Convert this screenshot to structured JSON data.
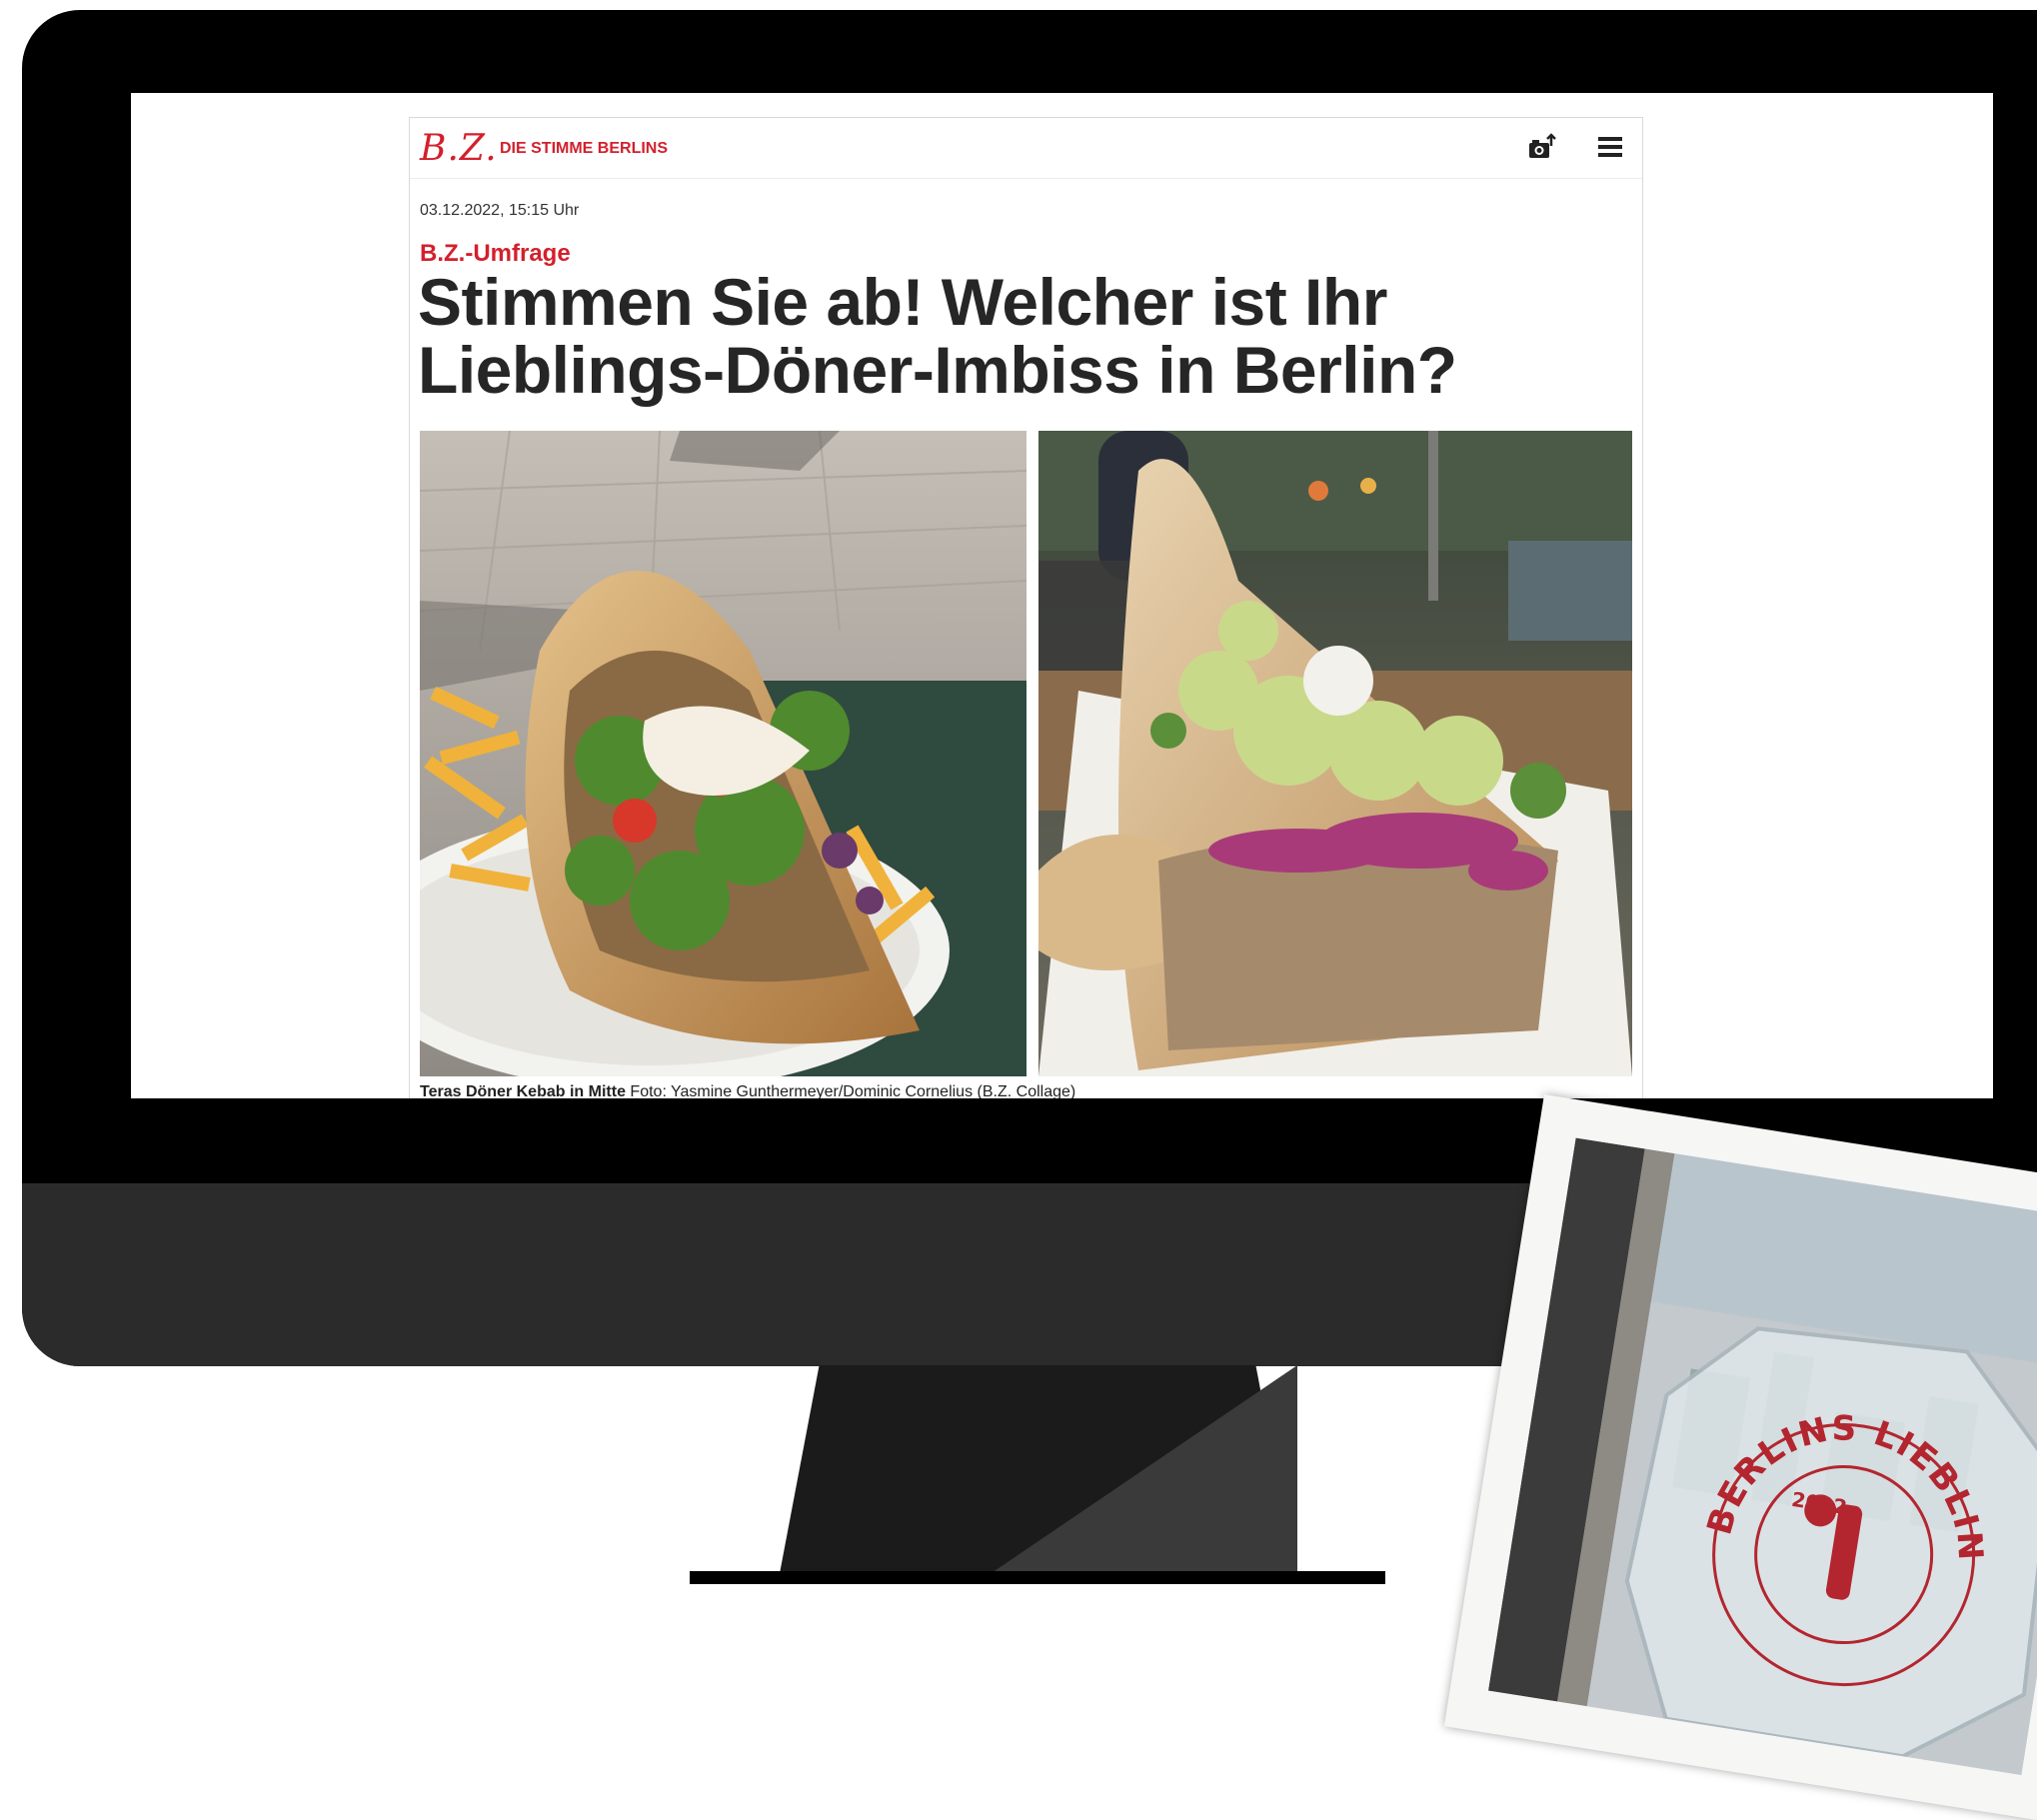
{
  "article": {
    "logo": "B.Z.",
    "tagline": "DIE STIMME BERLINS",
    "date": "03.12.2022, 15:15 Uhr",
    "kicker": "B.Z.-Umfrage",
    "headline_line1": "Stimmen Sie ab! Welcher ist Ihr",
    "headline_line2": "Lieblings-Döner-Imbiss in Berlin?",
    "caption_bold": "Teras Döner Kebab in Mitte",
    "caption_credit": "Foto: Yasmine Gunthermeyer/Dominic Cornelius (B.Z. Collage)"
  },
  "icons": {
    "photo": "camera-upload-icon",
    "menu": "hamburger-menu-icon"
  },
  "badge": {
    "text": "BERLINS LIEBLINGSDÖNER",
    "year": "2022"
  },
  "colors": {
    "brand_red": "#d3202c",
    "headline": "#262626",
    "monitor_frame": "#000000",
    "monitor_chin": "#2b2b2b"
  }
}
